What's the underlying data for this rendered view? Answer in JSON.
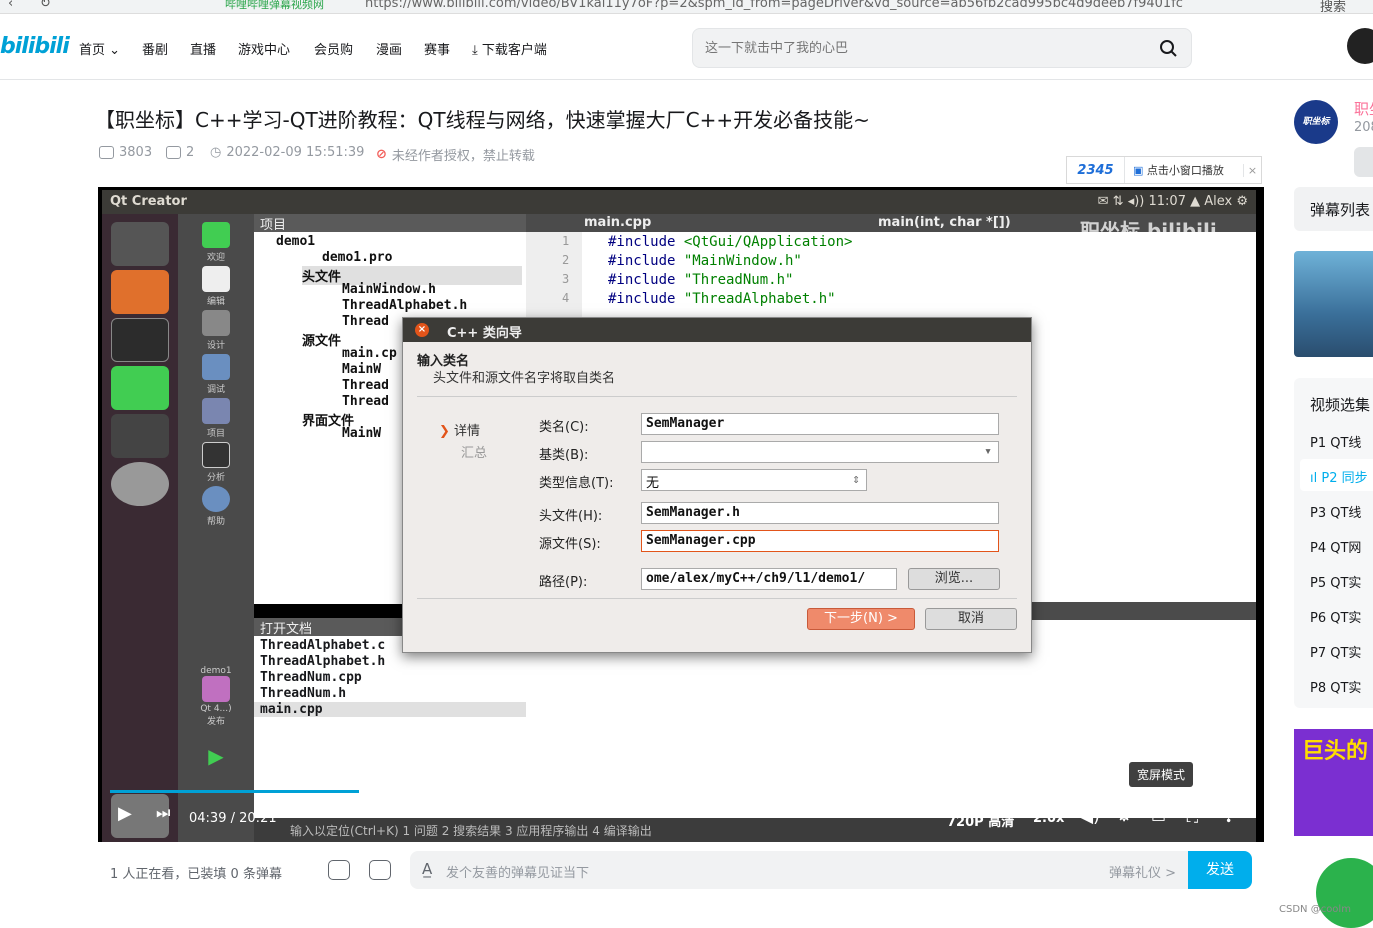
{
  "browser": {
    "tab_label": "哔哩哔哩弹幕视频网",
    "url": "https://www.bilibili.com/video/BV1kal11y7oF?p=2&spm_id_from=pageDriver&vd_source=ab56fb2cad995bc4d9deeb7f9401fc",
    "search_label": "搜索"
  },
  "header": {
    "logo": "bilibili",
    "nav": [
      {
        "label": "首页"
      },
      {
        "label": "番剧"
      },
      {
        "label": "直播"
      },
      {
        "label": "游戏中心"
      },
      {
        "label": "会员购"
      },
      {
        "label": "漫画"
      },
      {
        "label": "赛事"
      },
      {
        "label": "下载客户端"
      }
    ],
    "search_placeholder": "这一下就击中了我的心巴"
  },
  "video": {
    "title": "【职坐标】C++学习-QT进阶教程：QT线程与网络，快速掌握大厂C++开发必备技能~",
    "plays": "3803",
    "danmaku_count": "2",
    "date": "2022-02-09 15:51:39",
    "copyright": "未经作者授权，禁止转载"
  },
  "mini_widget": {
    "brand": "2345",
    "label": "点击小窗口播放",
    "close": "×"
  },
  "screen": {
    "window_title": "Qt Creator",
    "clock": "11:07",
    "user": "Alex",
    "project_header": "项目",
    "tree": [
      {
        "label": "demo1"
      },
      {
        "label": "demo1.pro"
      },
      {
        "label": "头文件"
      },
      {
        "label": "MainWindow.h"
      },
      {
        "label": "ThreadAlphabet.h"
      },
      {
        "label": "Thread"
      },
      {
        "label": "源文件"
      },
      {
        "label": "main.cp"
      },
      {
        "label": "MainW"
      },
      {
        "label": "Thread"
      },
      {
        "label": "Thread"
      },
      {
        "label": "界面文件"
      },
      {
        "label": "MainW"
      }
    ],
    "editor_file": "main.cpp",
    "editor_func": "main(int, char *[])",
    "code": [
      {
        "num": "1",
        "pre": "#include ",
        "inc": "<QtGui/QApplication>"
      },
      {
        "num": "2",
        "pre": "#include ",
        "inc": "\"MainWindow.h\""
      },
      {
        "num": "3",
        "pre": "#include ",
        "inc": "\"ThreadNum.h\""
      },
      {
        "num": "4",
        "pre": "#include ",
        "inc": "\"ThreadAlphabet.h\""
      }
    ],
    "watermark": "职坐标 bilibili",
    "open_docs_header": "打开文档",
    "open_docs": [
      "ThreadAlphabet.c",
      "ThreadAlphabet.h",
      "ThreadNum.cpp",
      "ThreadNum.h",
      "main.cpp"
    ],
    "modes": [
      "欢迎",
      "编辑",
      "设计",
      "调试",
      "项目",
      "分析",
      "帮助"
    ],
    "kit_label": "demo1",
    "kit_release": "Qt 4...) 发布",
    "bottom_strip": "输入以定位(Ctrl+K)    1 问题   2 搜索结果   3 应用程序输出   4 编译输出"
  },
  "dialog": {
    "title": "C++ 类向导",
    "heading": "输入类名",
    "subheading": "头文件和源文件名字将取自类名",
    "step_current": "详情",
    "step_next": "汇总",
    "class_name_label": "类名(C):",
    "class_name_value": "SemManager",
    "base_class_label": "基类(B):",
    "base_class_value": "",
    "type_info_label": "类型信息(T):",
    "type_info_value": "无",
    "header_label": "头文件(H):",
    "header_value": "SemManager.h",
    "source_label": "源文件(S):",
    "source_value": "SemManager.cpp",
    "path_label": "路径(P):",
    "path_value": "ome/alex/myC++/ch9/l1/demo1/",
    "browse": "浏览...",
    "next": "下一步(N) >",
    "cancel": "取消"
  },
  "player": {
    "progress": 0.218,
    "current_time": "04:39",
    "separator": "/",
    "total_time": "20:21",
    "quality": "720P 高清",
    "speed": "2.0x",
    "tooltip": "宽屏模式"
  },
  "danmaku_bar": {
    "viewers": "1 人正在看，已装填 0 条弹幕",
    "placeholder": "发个友善的弹幕见证当下",
    "etiquette": "弹幕礼仪 >",
    "send": "发送"
  },
  "sidebar": {
    "up_name": "职坐",
    "up_fans": "208",
    "up_badge": "职坐标",
    "danmaku_list": "弹幕列表",
    "selection_title": "视频选集",
    "episodes": [
      {
        "label": "P1  QT线"
      },
      {
        "label": "P2  同步"
      },
      {
        "label": "P3  QT线"
      },
      {
        "label": "P4  QT网"
      },
      {
        "label": "P5  QT实"
      },
      {
        "label": "P6  QT实"
      },
      {
        "label": "P7  QT实"
      },
      {
        "label": "P8  QT实"
      }
    ],
    "banner_text": "巨头的"
  },
  "footer": {
    "csdn": "CSDN @coolm"
  },
  "colors": {
    "bilibili_blue": "#00a1d6",
    "send_blue": "#00aeec",
    "pink": "#fb7299",
    "ubuntu_orange": "#e2541a"
  }
}
